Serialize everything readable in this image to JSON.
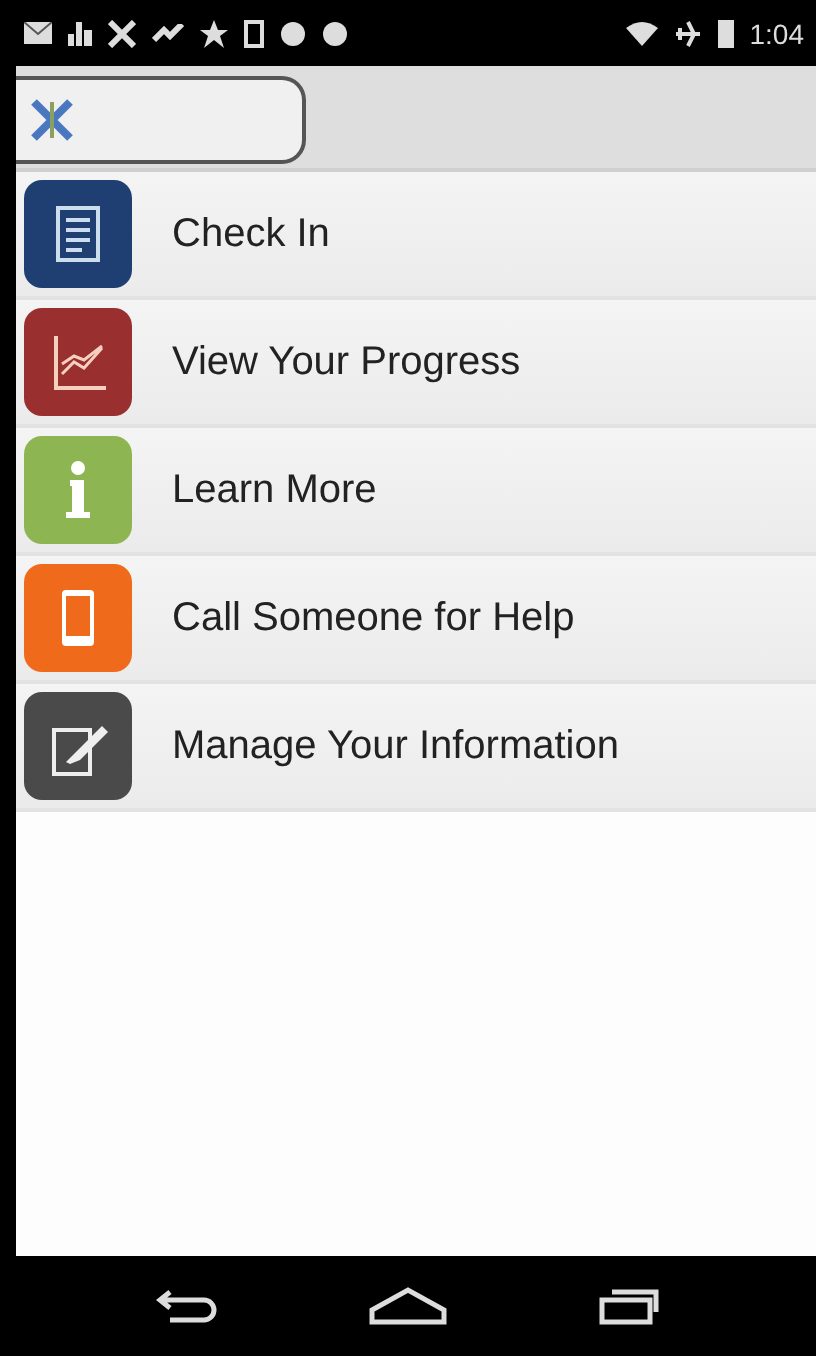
{
  "status_bar": {
    "time": "1:04"
  },
  "tabs": [
    {
      "selected": true
    }
  ],
  "menu": [
    {
      "label": "Check In",
      "color": "#1f3f73"
    },
    {
      "label": "View Your Progress",
      "color": "#9a2f2f"
    },
    {
      "label": "Learn More",
      "color": "#8db552"
    },
    {
      "label": "Call Someone for Help",
      "color": "#f06a1c"
    },
    {
      "label": "Manage Your Information",
      "color": "#4a4a4a"
    }
  ]
}
